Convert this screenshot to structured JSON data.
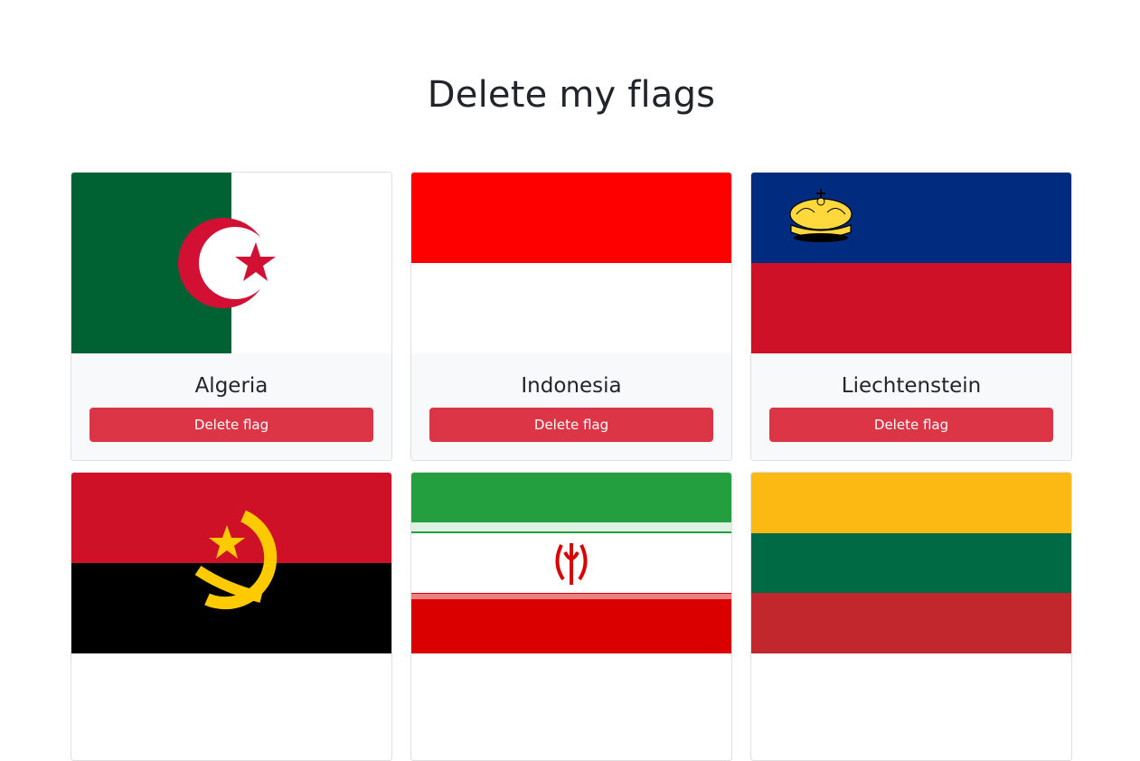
{
  "header": {
    "title": "Delete my flags"
  },
  "colors": {
    "danger": "#dc3545",
    "card_footer_bg": "#f8f9fa"
  },
  "cards": [
    {
      "country": "Algeria",
      "button_label": "Delete flag",
      "flag_icon": "algeria-flag"
    },
    {
      "country": "Indonesia",
      "button_label": "Delete flag",
      "flag_icon": "indonesia-flag"
    },
    {
      "country": "Liechtenstein",
      "button_label": "Delete flag",
      "flag_icon": "liechtenstein-flag"
    },
    {
      "country": "",
      "button_label": "",
      "flag_icon": "angola-flag"
    },
    {
      "country": "",
      "button_label": "",
      "flag_icon": "iran-flag"
    },
    {
      "country": "",
      "button_label": "",
      "flag_icon": "lithuania-flag"
    }
  ]
}
